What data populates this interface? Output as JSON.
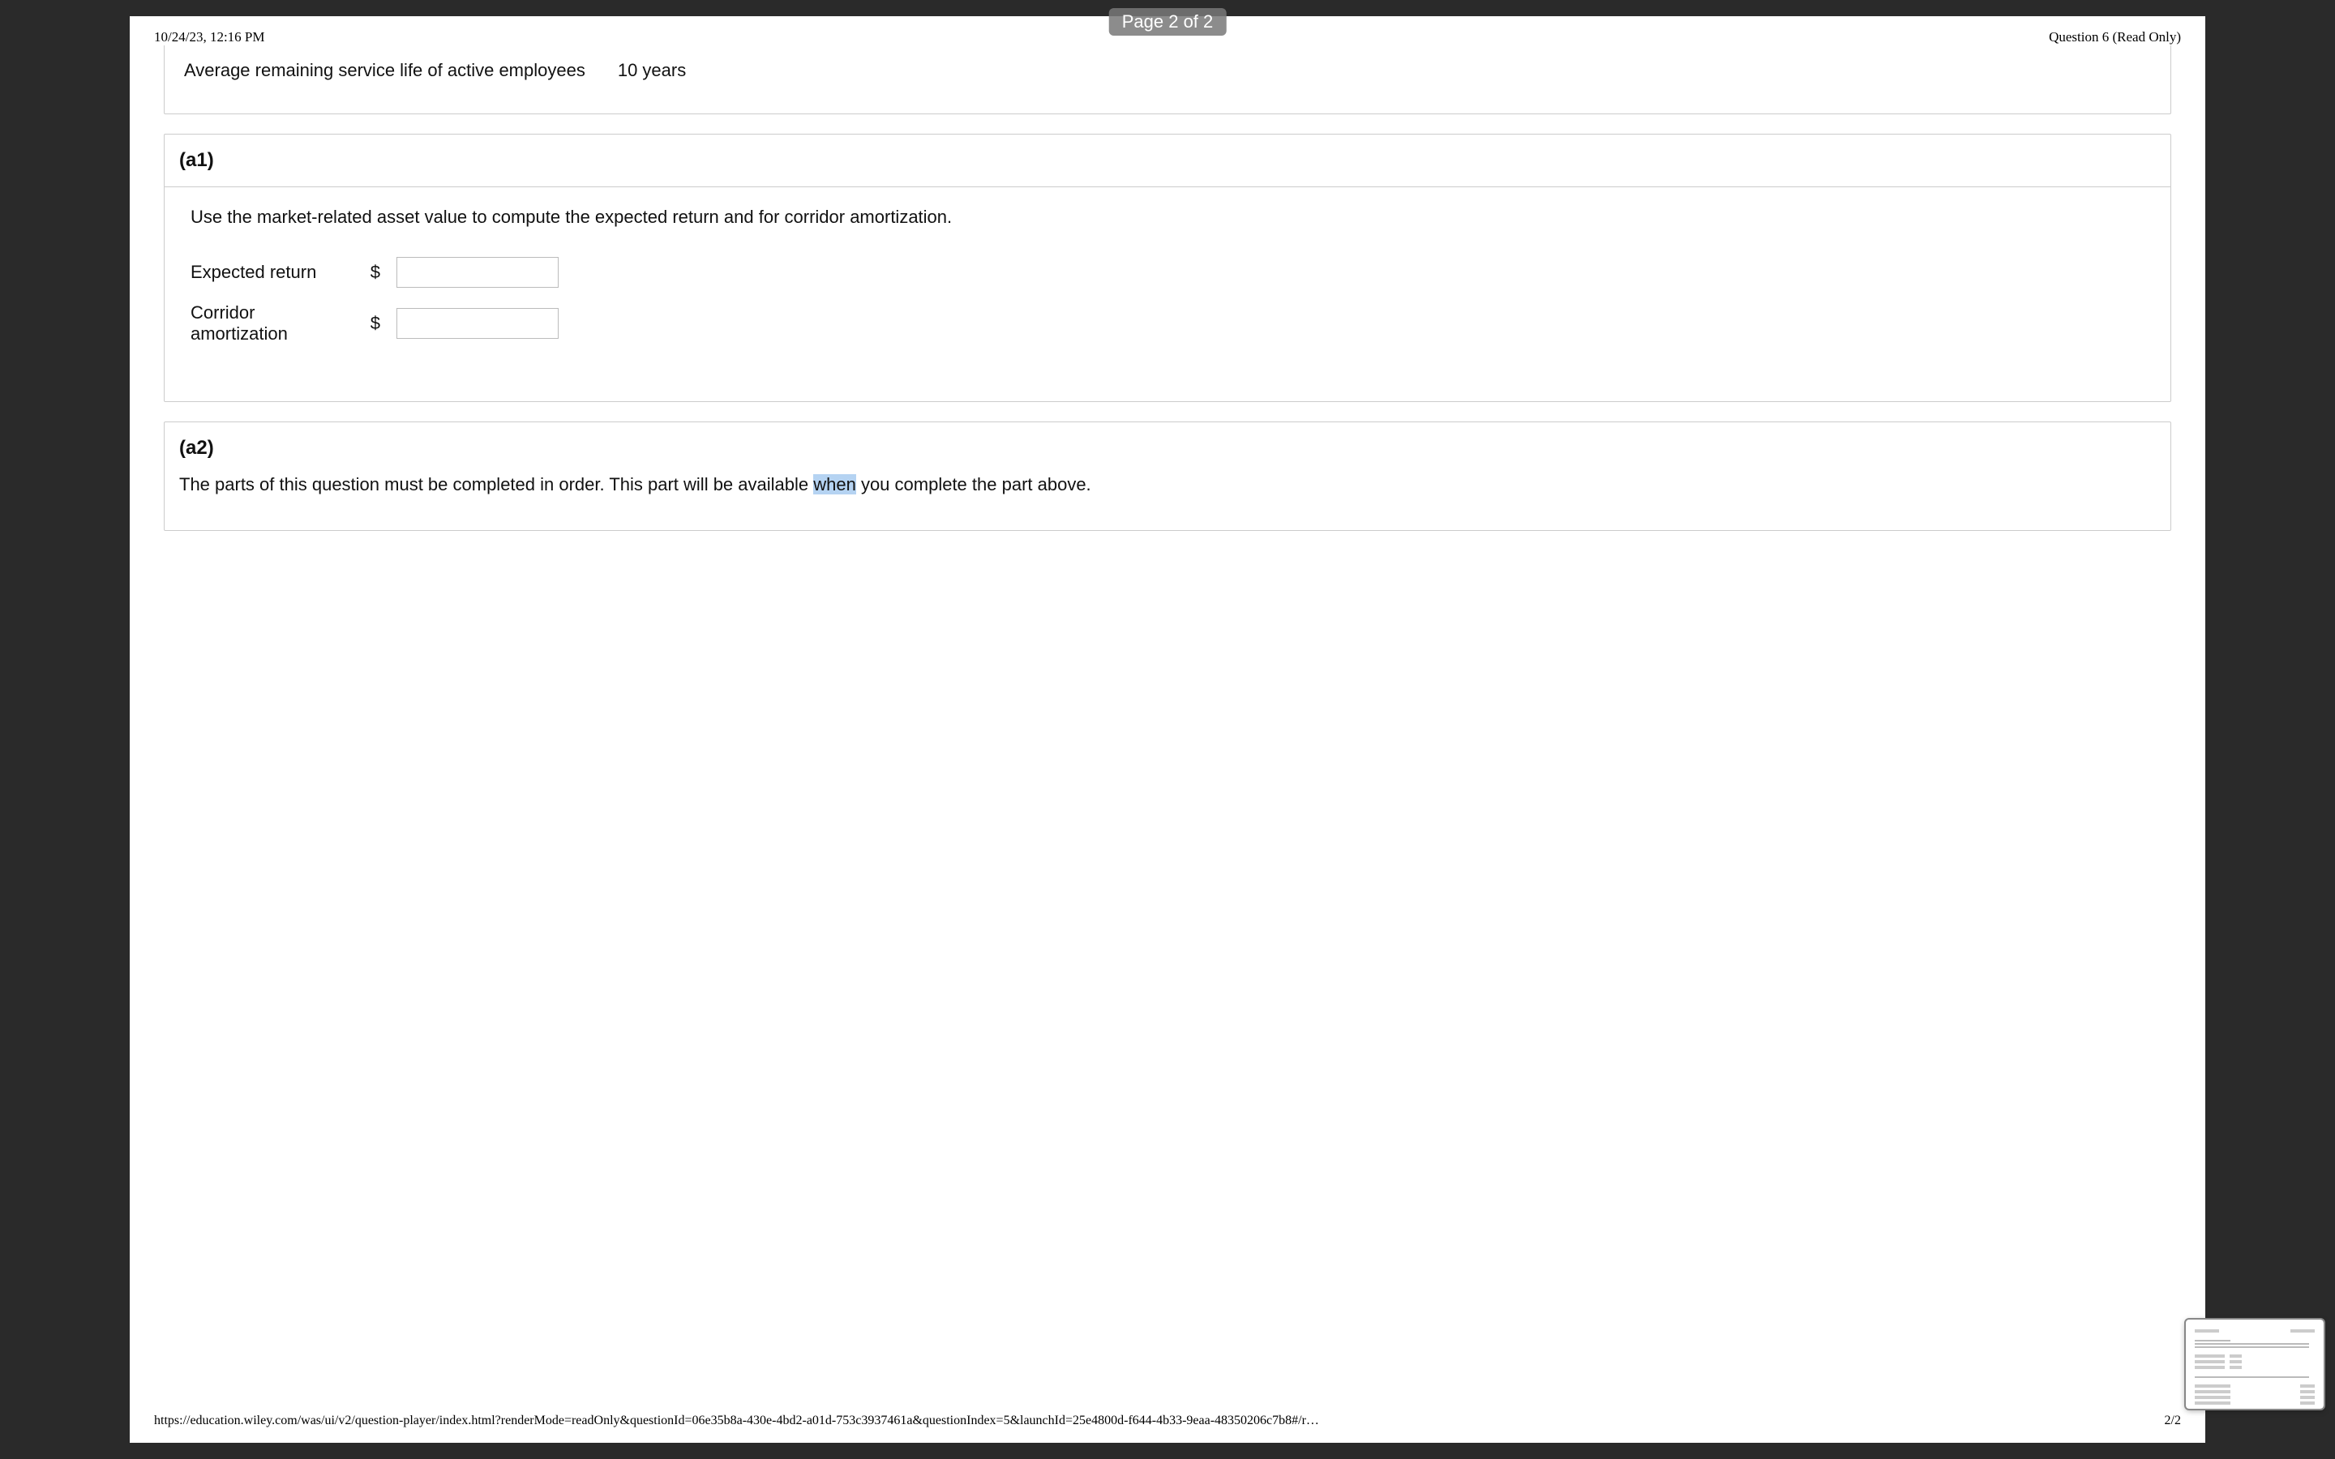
{
  "page_indicator": "Page 2 of 2",
  "header": {
    "left": "10/24/23, 12:16 PM",
    "right": "Question 6 (Read Only)"
  },
  "top_row": {
    "label": "Average remaining service life of active employees",
    "value": "10 years"
  },
  "section_a1": {
    "title": "(a1)",
    "instruction": "Use the market-related asset value to compute the expected return and for corridor amortization.",
    "fields": [
      {
        "label": "Expected return",
        "currency": "$",
        "value": ""
      },
      {
        "label": "Corridor amortization",
        "currency": "$",
        "value": ""
      }
    ]
  },
  "section_a2": {
    "title": "(a2)",
    "text_pre": "The parts of this question must be completed in order. This part will be available ",
    "highlight": "when",
    "text_post": " you complete the part above."
  },
  "footer": {
    "url": "https://education.wiley.com/was/ui/v2/question-player/index.html?renderMode=readOnly&questionId=06e35b8a-430e-4bd2-a01d-753c3937461a&questionIndex=5&launchId=25e4800d-f644-4b33-9eaa-48350206c7b8#/r…",
    "page_num": "2/2"
  }
}
